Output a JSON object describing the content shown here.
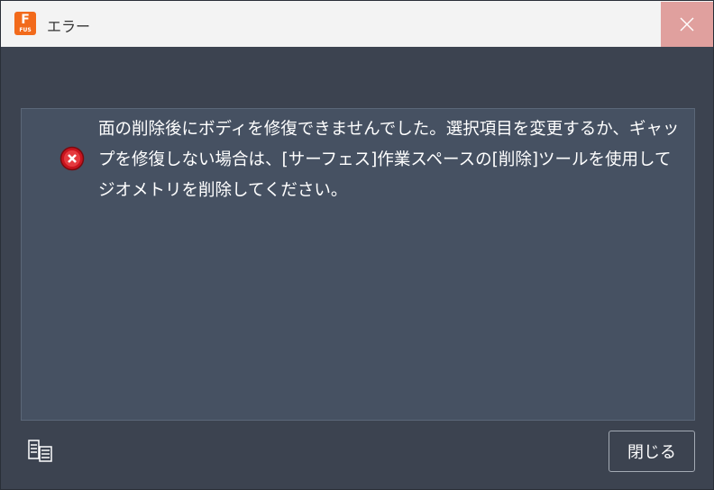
{
  "titlebar": {
    "app_icon_letter": "F",
    "app_icon_sub": "FUS",
    "title": "エラー",
    "close_icon": "close-icon",
    "accent": "#f26a1b"
  },
  "dialog": {
    "status_icon": "error-icon",
    "message": "面の削除後にボディを修復できませんでした。選択項目を変更するか、ギャップを修復しない場合は、[サーフェス]作業スペースの[削除]ツールを使用してジオメトリを削除してください。",
    "details_icon": "details-list-icon",
    "close_button_label": "閉じる"
  }
}
